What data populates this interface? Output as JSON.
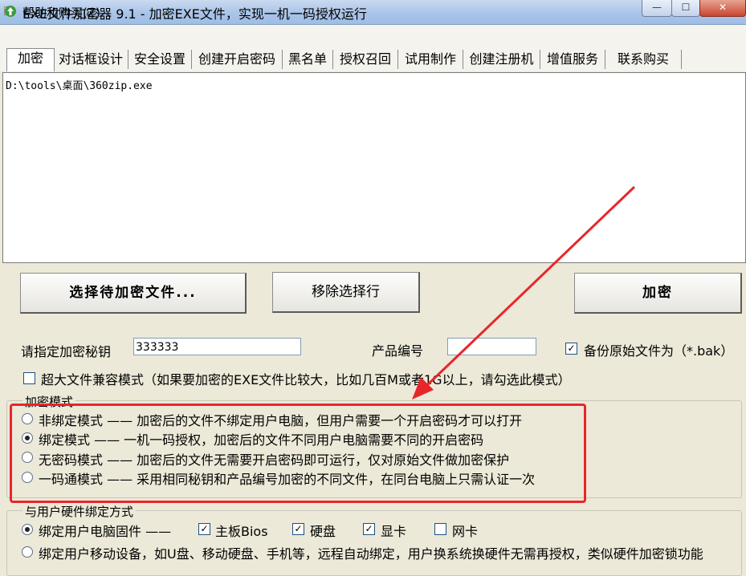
{
  "window": {
    "title": "EXE文件加密器 9.1 - 加密EXE文件，实现一机一码授权运行",
    "minimize": "—",
    "maximize": "☐",
    "close": "✕"
  },
  "menu": {
    "help_buy": "帮助和购买(Z)"
  },
  "tabs": [
    "加密",
    "对话框设计",
    "安全设置",
    "创建开启密码",
    "黑名单",
    "授权召回",
    "试用制作",
    "创建注册机",
    "增值服务",
    "联系购买"
  ],
  "file_list": {
    "items": [
      "D:\\tools\\桌面\\360zip.exe"
    ]
  },
  "buttons": {
    "select_file": "选择待加密文件...",
    "remove_row": "移除选择行",
    "encrypt": "加密"
  },
  "key": {
    "label": "请指定加密秘钥",
    "value": "333333"
  },
  "product": {
    "label": "产品编号",
    "value": ""
  },
  "backup": {
    "label": "备份原始文件为（*.bak）",
    "checked": true
  },
  "large_file": {
    "label": "超大文件兼容模式（如果要加密的EXE文件比较大，比如几百M或者1G以上，请勾选此模式）",
    "checked": false
  },
  "encrypt_mode": {
    "title": "加密模式",
    "options": [
      {
        "label": "非绑定模式 —— 加密后的文件不绑定用户电脑，但用户需要一个开启密码才可以打开",
        "selected": false
      },
      {
        "label": "绑定模式 —— 一机一码授权，加密后的文件不同用户电脑需要不同的开启密码",
        "selected": true
      },
      {
        "label": "无密码模式 —— 加密后的文件无需要开启密码即可运行，仅对原始文件做加密保护",
        "selected": false
      },
      {
        "label": "一码通模式 —— 采用相同秘钥和产品编号加密的不同文件，在同台电脑上只需认证一次",
        "selected": false
      }
    ]
  },
  "hw_binding": {
    "title": "与用户硬件绑定方式",
    "firmware": {
      "label": "绑定用户电脑固件 ——",
      "selected": true
    },
    "components": [
      {
        "label": "主板Bios",
        "checked": true
      },
      {
        "label": "硬盘",
        "checked": true
      },
      {
        "label": "显卡",
        "checked": true
      },
      {
        "label": "网卡",
        "checked": false
      }
    ],
    "mobile": {
      "label": "绑定用户移动设备，如U盘、移动硬盘、手机等，远程自动绑定，用户换系统换硬件无需再授权，类似硬件加密锁功能",
      "selected": false
    }
  },
  "colors": {
    "annotation": "#e8262a"
  }
}
